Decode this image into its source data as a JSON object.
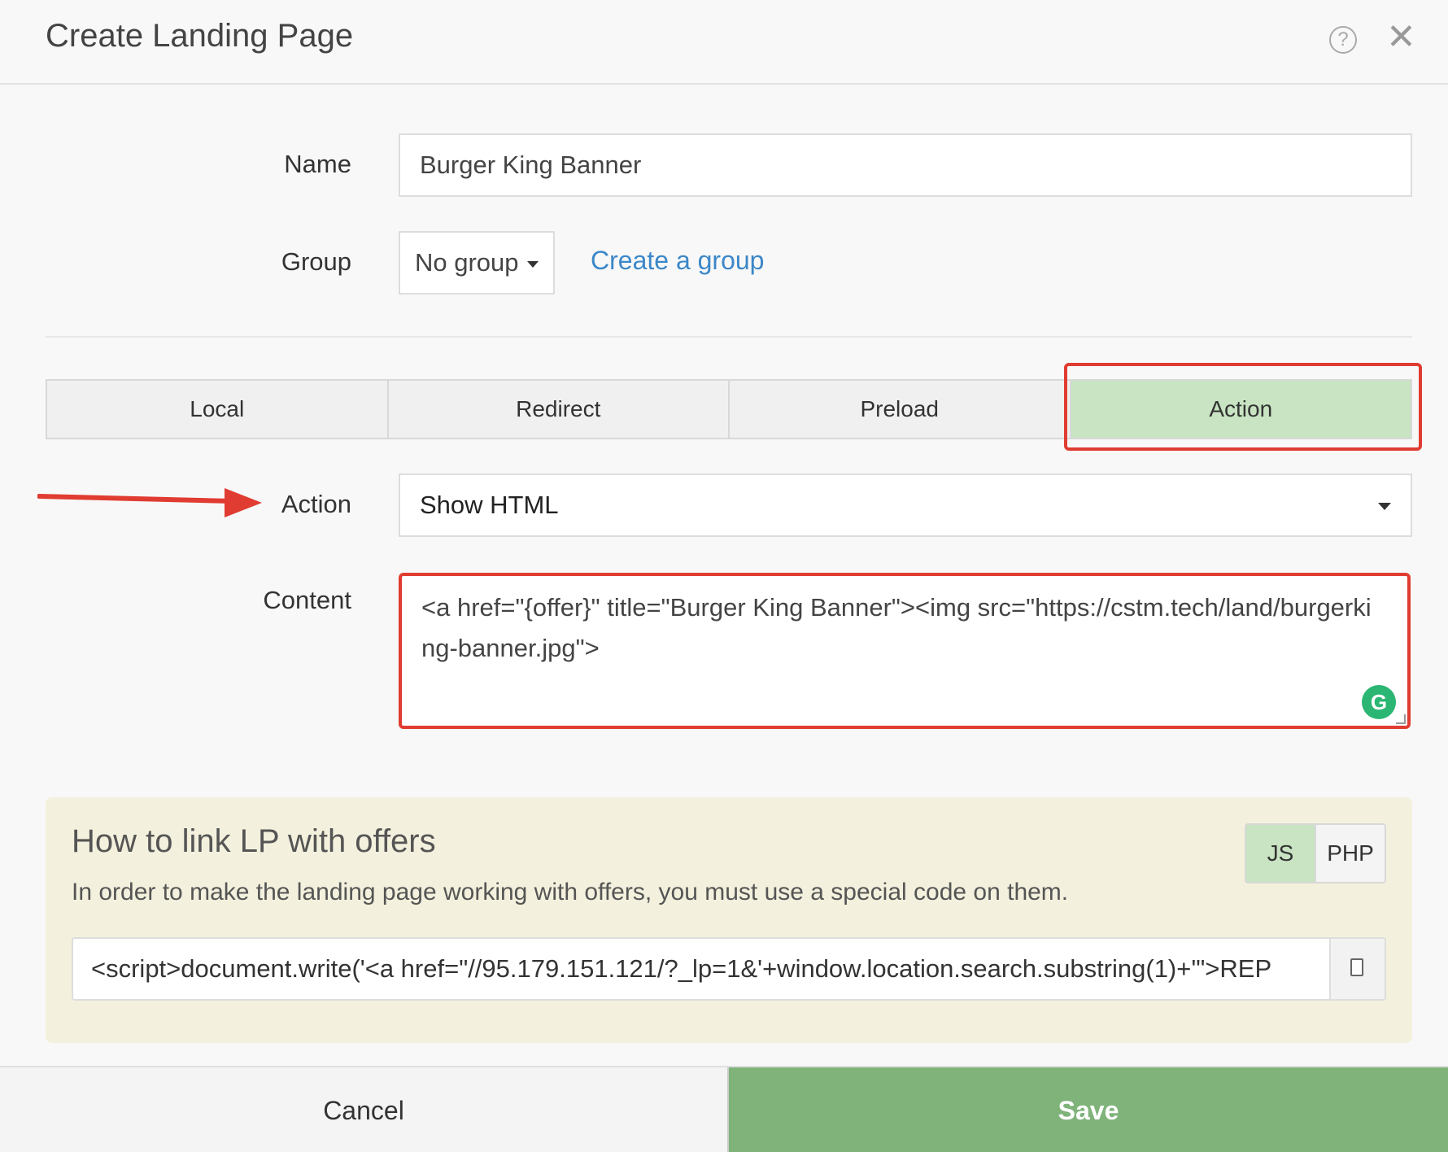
{
  "header": {
    "title": "Create Landing Page",
    "help_icon": "question-circle-icon",
    "help_glyph": "?",
    "close_icon": "close-icon",
    "close_glyph": "✕"
  },
  "form": {
    "name_label": "Name",
    "name_value": "Burger King Banner",
    "group_label": "Group",
    "group_value": "No group",
    "create_group_link": "Create a group",
    "tabs": [
      {
        "label": "Local",
        "active": false
      },
      {
        "label": "Redirect",
        "active": false
      },
      {
        "label": "Preload",
        "active": false
      },
      {
        "label": "Action",
        "active": true
      }
    ],
    "action_label": "Action",
    "action_value": "Show HTML",
    "content_label": "Content",
    "content_value": "<a href=\"{offer}\" title=\"Burger King Banner\"><img src=\"https://cstm.tech/land/burgerking-banner.jpg\">",
    "grammarly_glyph": "G"
  },
  "info": {
    "title": "How to link LP with offers",
    "toggle": [
      {
        "label": "JS",
        "active": true
      },
      {
        "label": "PHP",
        "active": false
      }
    ],
    "description": "In order to make the landing page working with offers, you must use a special code on them.",
    "code": "<script>document.write('<a href=\"//95.179.151.121/?_lp=1&'+window.location.search.substring(1)+'\">REP"
  },
  "footer": {
    "cancel_label": "Cancel",
    "save_label": "Save"
  },
  "colors": {
    "accent_green": "#7fb37a",
    "active_tab": "#c8e4c2",
    "highlight_red": "#e03c31",
    "link_blue": "#3c87c8",
    "info_bg": "#f3f1dd"
  }
}
